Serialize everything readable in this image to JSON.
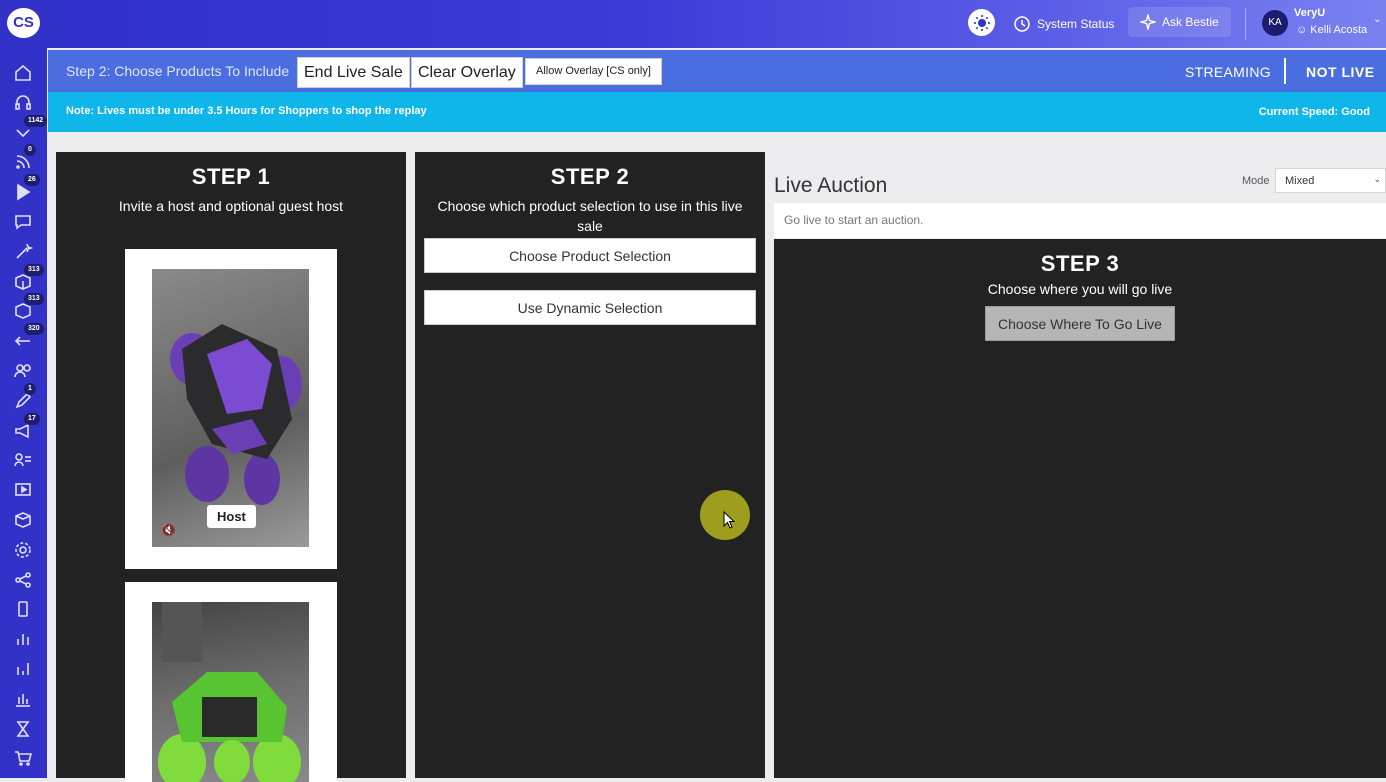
{
  "app": {
    "logo_text": "CS"
  },
  "sidebar": {
    "items": [
      {
        "icon": "home-icon",
        "badge": ""
      },
      {
        "icon": "headset-icon",
        "badge": ""
      },
      {
        "icon": "chevron-down-icon",
        "badge": "1142"
      },
      {
        "icon": "rss-icon",
        "badge": "0"
      },
      {
        "icon": "play-icon",
        "badge": "26"
      },
      {
        "icon": "chat-icon",
        "badge": ""
      },
      {
        "icon": "magic-wand-icon",
        "badge": ""
      },
      {
        "icon": "box-icon",
        "badge": "313"
      },
      {
        "icon": "box-refresh-icon",
        "badge": "313"
      },
      {
        "icon": "return-arrow-icon",
        "badge": "320"
      },
      {
        "icon": "users-icon",
        "badge": ""
      },
      {
        "icon": "pen-icon",
        "badge": "1"
      },
      {
        "icon": "megaphone-icon",
        "badge": "17"
      },
      {
        "icon": "user-list-icon",
        "badge": ""
      },
      {
        "icon": "video-icon",
        "badge": ""
      },
      {
        "icon": "package-icon",
        "badge": ""
      },
      {
        "icon": "gear-icon",
        "badge": ""
      },
      {
        "icon": "share-icon",
        "badge": ""
      },
      {
        "icon": "mobile-icon",
        "badge": ""
      },
      {
        "icon": "bar-chart-icon",
        "badge": ""
      },
      {
        "icon": "bar-chart-2-icon",
        "badge": ""
      },
      {
        "icon": "analytics-icon",
        "badge": ""
      },
      {
        "icon": "hourglass-icon",
        "badge": ""
      },
      {
        "icon": "cart-icon",
        "badge": ""
      }
    ]
  },
  "header": {
    "system_status": "System Status",
    "ask_bestie": "Ask Bestie",
    "avatar_initials": "KA",
    "org_name": "VeryU",
    "user_name": "Kelli Acosta"
  },
  "stepbar": {
    "step_label": "Step 2: Choose Products To Include",
    "end_live_sale": "End Live Sale",
    "clear_overlay": "Clear Overlay",
    "allow_overlay": "Allow Overlay [CS only]",
    "streaming": "STREAMING",
    "live_status": "NOT LIVE"
  },
  "notebar": {
    "note": "Note: Lives must be under 3.5 Hours for Shoppers to shop the replay",
    "speed": "Current Speed: Good"
  },
  "step1": {
    "title": "STEP 1",
    "subtitle": "Invite a host and optional guest host",
    "host_label": "Host"
  },
  "step2": {
    "title": "STEP 2",
    "subtitle": "Choose which product selection to use in this live sale",
    "choose_product": "Choose Product Selection",
    "dynamic_selection": "Use Dynamic Selection"
  },
  "auction": {
    "title": "Live Auction",
    "mode_label": "Mode",
    "mode_value": "Mixed",
    "message": "Go live to start an auction."
  },
  "step3": {
    "title": "STEP 3",
    "subtitle": "Choose where you will go live",
    "go_live_button": "Choose Where To Go Live"
  },
  "colors": {
    "sidebar": "#3232c8",
    "stepbar": "#4a6de0",
    "notebar": "#0fb6e9",
    "panel": "#222222"
  }
}
